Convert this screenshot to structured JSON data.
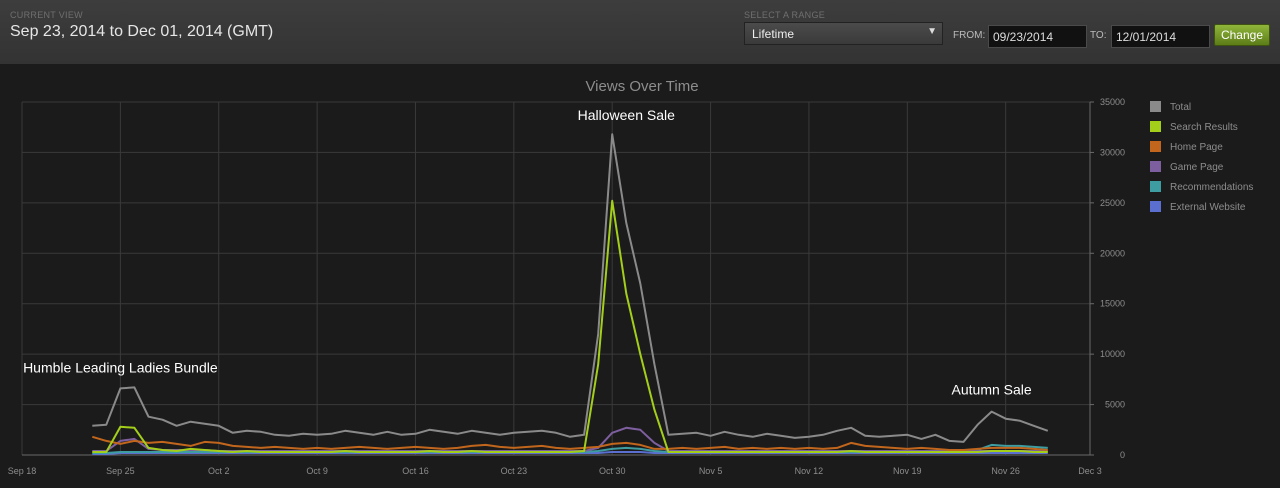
{
  "header": {
    "current_view_label": "CURRENT VIEW",
    "current_view_value": "Sep 23, 2014 to Dec 01, 2014 (GMT)",
    "range_label": "SELECT A RANGE",
    "range_selected": "Lifetime",
    "from_label": "FROM:",
    "from_value": "09/23/2014",
    "to_label": "TO:",
    "to_value": "12/01/2014",
    "change_label": "Change"
  },
  "chart_data": {
    "type": "line",
    "title": "Views Over Time",
    "x_start": "2014-09-23",
    "x_range": [
      "2014-09-18",
      "2014-12-03"
    ],
    "x_ticks": [
      "Sep 18",
      "Sep 25",
      "Oct 2",
      "Oct 9",
      "Oct 16",
      "Oct 23",
      "Oct 30",
      "Nov 5",
      "Nov 12",
      "Nov 19",
      "Nov 26",
      "Dec 3"
    ],
    "y_ticks": [
      "0",
      "5000",
      "10000",
      "15000",
      "20000",
      "25000",
      "30000",
      "35000"
    ],
    "ylim": [
      0,
      35000
    ],
    "grid": true,
    "legend_position": "right",
    "annotations": [
      {
        "text": "Humble Leading Ladies Bundle",
        "date": "2014-09-25",
        "value": 8200
      },
      {
        "text": "Halloween Sale",
        "date": "2014-10-31",
        "value": 33200
      },
      {
        "text": "Autumn Sale",
        "date": "2014-11-26",
        "value": 6000
      }
    ],
    "series": [
      {
        "name": "Total",
        "color": "#8a8a8a",
        "values": [
          2900,
          3000,
          6600,
          6700,
          3800,
          3500,
          2900,
          3300,
          3100,
          2900,
          2200,
          2400,
          2300,
          2000,
          1900,
          2100,
          2000,
          2100,
          2400,
          2200,
          2000,
          2300,
          2000,
          2100,
          2500,
          2300,
          2100,
          2400,
          2200,
          2000,
          2200,
          2300,
          2400,
          2200,
          1800,
          2000,
          12000,
          31800,
          23000,
          17000,
          9000,
          2000,
          2100,
          2200,
          1900,
          2300,
          2000,
          1800,
          2100,
          1900,
          1700,
          1800,
          2000,
          2400,
          2700,
          1900,
          1800,
          1900,
          2000,
          1600,
          2000,
          1400,
          1300,
          3000,
          4300,
          3600,
          3400,
          2900,
          2400
        ]
      },
      {
        "name": "Search Results",
        "color": "#a3cf1b",
        "values": [
          300,
          300,
          2800,
          2700,
          700,
          500,
          400,
          600,
          500,
          400,
          300,
          400,
          300,
          300,
          300,
          300,
          300,
          300,
          400,
          300,
          300,
          300,
          300,
          300,
          400,
          300,
          300,
          400,
          300,
          300,
          300,
          300,
          300,
          300,
          300,
          400,
          9000,
          25200,
          16000,
          10000,
          4500,
          300,
          300,
          300,
          300,
          300,
          300,
          300,
          300,
          300,
          300,
          300,
          300,
          300,
          400,
          300,
          300,
          300,
          300,
          300,
          300,
          300,
          300,
          300,
          400,
          400,
          400,
          300,
          300
        ]
      },
      {
        "name": "Home Page",
        "color": "#c1661c",
        "values": [
          1800,
          1400,
          1100,
          1400,
          1200,
          1300,
          1100,
          900,
          1300,
          1200,
          900,
          800,
          700,
          800,
          700,
          600,
          700,
          600,
          700,
          800,
          700,
          600,
          700,
          800,
          700,
          600,
          700,
          900,
          1000,
          800,
          700,
          800,
          900,
          700,
          600,
          700,
          800,
          1100,
          1200,
          1000,
          600,
          600,
          700,
          600,
          700,
          800,
          600,
          700,
          600,
          700,
          600,
          700,
          600,
          700,
          1200,
          900,
          800,
          700,
          600,
          700,
          600,
          500,
          500,
          600,
          700,
          700,
          700,
          600,
          500
        ]
      },
      {
        "name": "Game Page",
        "color": "#7d5f9f",
        "values": [
          400,
          400,
          1400,
          1600,
          600,
          500,
          500,
          500,
          500,
          400,
          400,
          400,
          400,
          400,
          400,
          400,
          400,
          400,
          400,
          400,
          400,
          400,
          400,
          400,
          400,
          400,
          400,
          400,
          400,
          400,
          400,
          400,
          400,
          400,
          400,
          400,
          700,
          2200,
          2700,
          2500,
          1200,
          400,
          400,
          400,
          400,
          400,
          400,
          400,
          400,
          400,
          400,
          400,
          400,
          400,
          400,
          400,
          400,
          400,
          400,
          400,
          400,
          400,
          400,
          400,
          400,
          400,
          400,
          400,
          400
        ]
      },
      {
        "name": "Recommendations",
        "color": "#3d9da1",
        "values": [
          200,
          200,
          300,
          300,
          300,
          300,
          300,
          300,
          300,
          300,
          300,
          300,
          300,
          300,
          300,
          300,
          300,
          300,
          300,
          300,
          300,
          300,
          300,
          300,
          300,
          300,
          300,
          300,
          300,
          300,
          300,
          300,
          300,
          300,
          300,
          300,
          400,
          600,
          700,
          600,
          400,
          300,
          300,
          300,
          300,
          300,
          300,
          300,
          300,
          300,
          300,
          300,
          300,
          300,
          300,
          300,
          300,
          300,
          300,
          300,
          300,
          300,
          300,
          500,
          1000,
          900,
          900,
          800,
          700
        ]
      },
      {
        "name": "External Website",
        "color": "#5a6fd0",
        "values": [
          100,
          100,
          200,
          200,
          200,
          200,
          200,
          200,
          200,
          200,
          200,
          200,
          200,
          200,
          200,
          200,
          200,
          200,
          200,
          200,
          200,
          200,
          200,
          200,
          200,
          200,
          200,
          200,
          200,
          200,
          200,
          200,
          200,
          200,
          200,
          200,
          200,
          300,
          300,
          300,
          200,
          200,
          200,
          200,
          200,
          200,
          200,
          200,
          200,
          200,
          200,
          200,
          200,
          200,
          200,
          200,
          200,
          200,
          200,
          200,
          200,
          200,
          200,
          200,
          200,
          200,
          200,
          200,
          200
        ]
      }
    ]
  }
}
